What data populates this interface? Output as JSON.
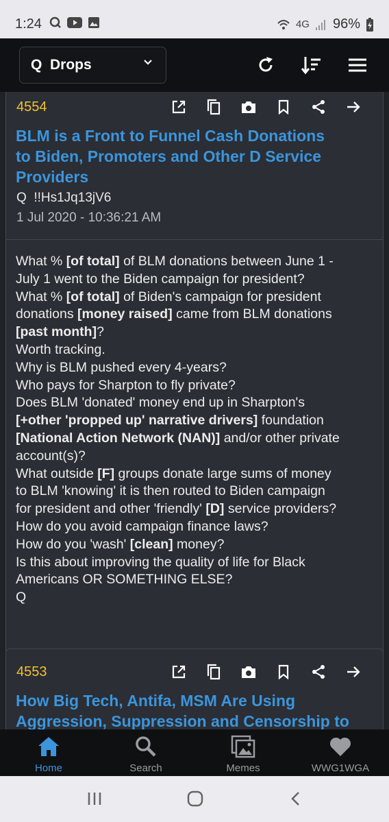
{
  "status_bar": {
    "time": "1:24",
    "network": "4G",
    "battery": "96%"
  },
  "app_bar": {
    "dropdown_label": "Q  Drops"
  },
  "posts": [
    {
      "number": "4554",
      "title_lines": [
        "BLM is a Front to Funnel Cash Donations",
        "to Biden, Promoters and Other D Service",
        "Providers"
      ],
      "author": "Q  !!Hs1Jq13jV6",
      "date": "1 Jul 2020 - 10:36:21 AM",
      "body_lines": [
        [
          {
            "t": "What % "
          },
          {
            "t": "[of total]",
            "b": true
          },
          {
            "t": " of BLM donations between June 1 -"
          }
        ],
        [
          {
            "t": "July 1 went to the Biden campaign for president?"
          }
        ],
        [
          {
            "t": "What % "
          },
          {
            "t": "[of total]",
            "b": true
          },
          {
            "t": " of Biden's campaign for president"
          }
        ],
        [
          {
            "t": "donations "
          },
          {
            "t": "[money raised]",
            "b": true
          },
          {
            "t": " came from BLM donations"
          }
        ],
        [
          {
            "t": "[past month]",
            "b": true
          },
          {
            "t": "?"
          }
        ],
        [
          {
            "t": "Worth tracking."
          }
        ],
        [
          {
            "t": "Why is BLM pushed every 4-years?"
          }
        ],
        [
          {
            "t": "Who pays for Sharpton to fly private?"
          }
        ],
        [
          {
            "t": "Does BLM 'donated' money end up in Sharpton's"
          }
        ],
        [
          {
            "t": "[+other 'propped up' narrative drivers]",
            "b": true
          },
          {
            "t": " foundation"
          }
        ],
        [
          {
            "t": "[National Action Network (NAN)]",
            "b": true
          },
          {
            "t": " and/or other private"
          }
        ],
        [
          {
            "t": "account(s)?"
          }
        ],
        [
          {
            "t": "What outside "
          },
          {
            "t": "[F]",
            "b": true
          },
          {
            "t": " groups donate large sums of money"
          }
        ],
        [
          {
            "t": "to BLM 'knowing' it is then routed to Biden campaign"
          }
        ],
        [
          {
            "t": "for president and other 'friendly' "
          },
          {
            "t": "[D]",
            "b": true
          },
          {
            "t": " service providers?"
          }
        ],
        [
          {
            "t": "How do you avoid campaign finance laws?"
          }
        ],
        [
          {
            "t": "How do you 'wash' "
          },
          {
            "t": "[clean]",
            "b": true
          },
          {
            "t": " money?"
          }
        ],
        [
          {
            "t": "Is this about improving the quality of life for Black"
          }
        ],
        [
          {
            "t": "Americans OR SOMETHING ELSE?"
          }
        ],
        [
          {
            "t": "Q"
          }
        ]
      ]
    },
    {
      "number": "4553",
      "title_lines": [
        "How Big Tech, Antifa, MSM Are Using",
        "Aggression, Suppression and Censorship to"
      ]
    }
  ],
  "post_actions": [
    "open-external-icon",
    "copy-icon",
    "camera-icon",
    "bookmark-icon",
    "share-icon",
    "forward-icon"
  ],
  "bottom_nav": [
    {
      "label": "Home",
      "icon": "home-icon",
      "active": true
    },
    {
      "label": "Search",
      "icon": "search-icon",
      "active": false
    },
    {
      "label": "Memes",
      "icon": "images-icon",
      "active": false
    },
    {
      "label": "WWG1WGA",
      "icon": "heart-icon",
      "active": false
    }
  ],
  "colors": {
    "accent": "#3b95dd",
    "post_number": "#f2c230",
    "background": "#1f2227",
    "card": "#2b2e34"
  }
}
